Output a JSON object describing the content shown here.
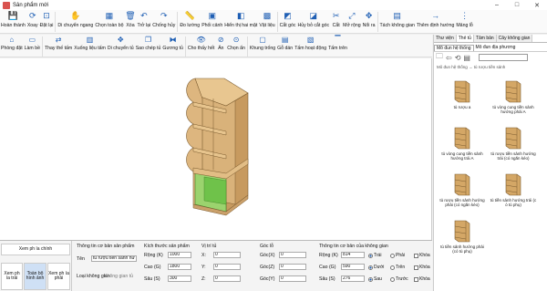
{
  "window": {
    "title": "Sản phẩm mới"
  },
  "toolbar": [
    {
      "label": "Hoàn thành",
      "icon": "save-icon",
      "glyph": "💾"
    },
    {
      "label": "Xoay",
      "icon": "rotate-icon",
      "glyph": "⟳"
    },
    {
      "label": "Đặt lại",
      "icon": "reset-icon",
      "glyph": "⊡"
    },
    {
      "label": "Di chuyển ngang",
      "icon": "hand-icon",
      "glyph": "✋"
    },
    {
      "label": "Chọn toàn bộ",
      "icon": "select-all-icon",
      "glyph": "▦"
    },
    {
      "label": "Xóa",
      "icon": "delete-icon",
      "glyph": "🗑"
    },
    {
      "label": "Trở lại",
      "icon": "undo-icon",
      "glyph": "↶"
    },
    {
      "label": "Chống hủy",
      "icon": "redo-icon",
      "glyph": "↷"
    },
    {
      "label": "Đo lường",
      "icon": "measure-icon",
      "glyph": "📏"
    },
    {
      "label": "Phối cảnh",
      "icon": "perspective-icon",
      "glyph": "▣"
    },
    {
      "label": "Hiển thị hai mặt",
      "icon": "double-side-icon",
      "glyph": "◧"
    },
    {
      "label": "Vật liệu",
      "icon": "material-icon",
      "glyph": "▩"
    },
    {
      "label": "Cắt góc",
      "icon": "cut-corner-icon",
      "glyph": "◩"
    },
    {
      "label": "Hủy bỏ cắt góc",
      "icon": "cancel-cut-icon",
      "glyph": "◪"
    },
    {
      "label": "Cắt",
      "icon": "scissors-icon",
      "glyph": "✂"
    },
    {
      "label": "Mở rộng",
      "icon": "expand-icon",
      "glyph": "⤢"
    },
    {
      "label": "Nổi ra",
      "icon": "extrude-icon",
      "glyph": "✥"
    },
    {
      "label": "Tách không gian",
      "icon": "split-space-icon",
      "glyph": "▤"
    },
    {
      "label": "Thêm định hướng",
      "icon": "add-direction-icon",
      "glyph": "→"
    },
    {
      "label": "Mảng lỗ",
      "icon": "hole-array-icon",
      "glyph": "⋮"
    }
  ],
  "toolbar2": [
    {
      "label": "Phòng đặt",
      "icon": "room-icon",
      "glyph": "⌂"
    },
    {
      "label": "Làm bề",
      "icon": "surface-icon",
      "glyph": "▭"
    },
    {
      "label": "Thay thế tấm",
      "icon": "replace-panel-icon",
      "glyph": "⇄"
    },
    {
      "label": "Xuống liệu tấm",
      "icon": "panel-material-icon",
      "glyph": "▥"
    },
    {
      "label": "Di chuyển tủ",
      "icon": "move-cabinet-icon",
      "glyph": "✥"
    },
    {
      "label": "Sao chép tủ",
      "icon": "copy-cabinet-icon",
      "glyph": "❐"
    },
    {
      "label": "Gương tủ",
      "icon": "mirror-icon",
      "glyph": "⧓"
    },
    {
      "label": "Cho thấy hết",
      "icon": "show-all-icon",
      "glyph": "👁"
    },
    {
      "label": "Ẩn",
      "icon": "hide-icon",
      "glyph": "⊘"
    },
    {
      "label": "Chọn ẩn",
      "icon": "select-hidden-icon",
      "glyph": "⊙"
    },
    {
      "label": "Khung trống",
      "icon": "empty-frame-icon",
      "glyph": "▢"
    },
    {
      "label": "Gỗ dán",
      "icon": "plywood-icon",
      "glyph": "▤"
    },
    {
      "label": "Tấm hoạt động",
      "icon": "active-panel-icon",
      "glyph": "▧"
    },
    {
      "label": "Tấm trên",
      "icon": "top-panel-icon",
      "glyph": "▔"
    }
  ],
  "panel": {
    "tabs": [
      "Thư viện",
      "Thẻ tủ",
      "Tâm bản",
      "Cây không gian"
    ],
    "active_tab": "Thẻ tủ",
    "subtabs": [
      "Mô đun hệ thống",
      "Mô đun địa phương"
    ],
    "breadcrumb": "Mô đun hệ thống → tủ rượu tiền sảnh",
    "items": [
      {
        "name": "tủ rượu a"
      },
      {
        "name": "tủ vòng cung tiền sảnh hướng phải A"
      },
      {
        "name": "tủ vòng cung tiền sảnh hướng trái A"
      },
      {
        "name": "tủ rượu tiền sảnh hướng trái (có ngăn kéo)"
      },
      {
        "name": "tủ rượu tiền sảnh hướng phải (có ngăn kéo)"
      },
      {
        "name": "tủ tiền sảnh hướng trái (c ó tủ phụ)"
      },
      {
        "name": "tủ tiền sảnh hướng phải (có tủ phụ)"
      }
    ]
  },
  "views": {
    "header": "Xem ph ía chính",
    "left": "Xem ph ía trái",
    "center": "Toàn bộ hình ảnh",
    "right": "Xem ph ía phải"
  },
  "props": {
    "basic_header": "Thông tin cơ bản sản phẩm",
    "name_label": "Tên",
    "name_value": "tủ rượu tiền sảnh hư",
    "type_label": "Loại không gian",
    "type_value": "Không gian tủ",
    "size_header": "Kích thước sản phẩm",
    "width_label": "Rộng (K)",
    "width_value": "1000",
    "height_label": "Cao (G)",
    "height_value": "1800",
    "depth_label": "Sâu (S)",
    "depth_value": "300",
    "pos_header": "Vị trí tủ",
    "x_label": "X:",
    "x_value": "0",
    "y_label": "Y:",
    "y_value": "0",
    "z_label": "Z:",
    "z_value": "0",
    "angle_header": "Góc lỗ",
    "ax_label": "Góc(X)",
    "ax_value": "0",
    "az_label": "Góc(Z)",
    "az_value": "0",
    "ay_label": "Góc(Y)",
    "ay_value": "0",
    "space_header": "Thông tin cơ bản của không gian",
    "s_width_label": "Rộng (K)",
    "s_width_value": "814",
    "s_height_label": "Cao (G)",
    "s_height_value": "590",
    "s_depth_label": "Sâu (S)",
    "s_depth_value": "276",
    "r1": "Trái",
    "r2": "Phải",
    "r3": "Dưới",
    "r4": "Trên",
    "r5": "Sau",
    "r6": "Trước",
    "k1": "Khóa",
    "k2": "Khóa",
    "k3": "Khóa"
  }
}
